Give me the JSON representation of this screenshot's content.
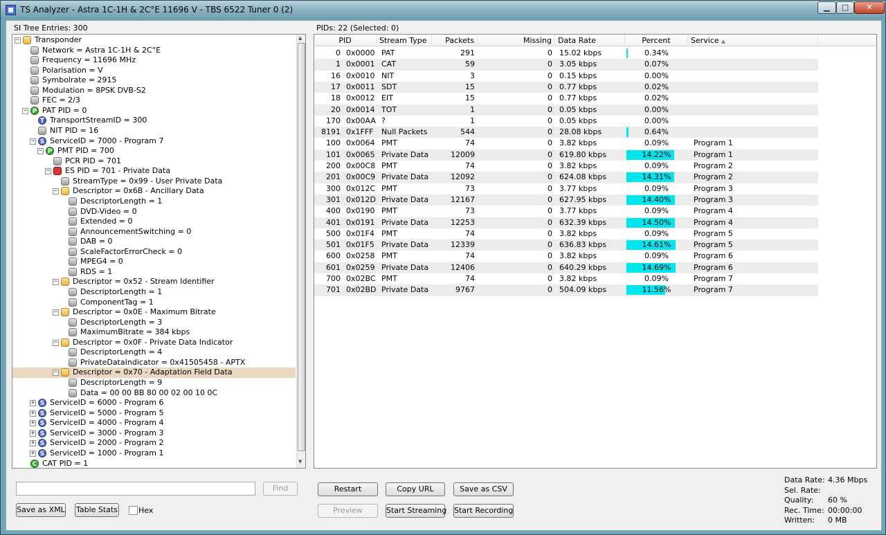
{
  "window": {
    "title": "TS Analyzer - Astra 1C-1H & 2C°E 11696 V - TBS 6522 Tuner 0 (2)",
    "controls": {
      "minimize": "▁",
      "maximize": "□",
      "close": "✕"
    }
  },
  "left": {
    "header": "SI Tree Entries: 300",
    "tree": [
      {
        "label": "Transponder",
        "level": 0,
        "icon": "folder",
        "exp": "-"
      },
      {
        "label": "Network = Astra 1C-1H & 2C°E",
        "level": 1,
        "icon": "gray"
      },
      {
        "label": "Frequency = 11696 MHz",
        "level": 1,
        "icon": "gray"
      },
      {
        "label": "Polarisation = V",
        "level": 1,
        "icon": "gray"
      },
      {
        "label": "Symbolrate = 2915",
        "level": 1,
        "icon": "gray"
      },
      {
        "label": "Modulation = 8PSK DVB-S2",
        "level": 1,
        "icon": "gray"
      },
      {
        "label": "FEC = 2/3",
        "level": 1,
        "icon": "gray"
      },
      {
        "label": "PAT PID = 0",
        "level": 1,
        "icon": "green",
        "glyph": "P",
        "exp": "-"
      },
      {
        "label": "TransportStreamID = 300",
        "level": 2,
        "icon": "blue",
        "glyph": "T"
      },
      {
        "label": "NIT PID = 16",
        "level": 2,
        "icon": "gray"
      },
      {
        "label": "ServiceID = 7000 - Program 7",
        "level": 2,
        "icon": "blue",
        "glyph": "S",
        "exp": "-"
      },
      {
        "label": "PMT PID = 700",
        "level": 3,
        "icon": "green",
        "glyph": "P",
        "exp": "-"
      },
      {
        "label": "PCR PID = 701",
        "level": 4,
        "icon": "gray"
      },
      {
        "label": "ES PID = 701 - Private Data",
        "level": 4,
        "icon": "red",
        "exp": "-"
      },
      {
        "label": "StreamType = 0x99 - User Private Data",
        "level": 5,
        "icon": "gray"
      },
      {
        "label": "Descriptor = 0x6B - Ancillary Data",
        "level": 5,
        "icon": "folder",
        "exp": "-"
      },
      {
        "label": "DescriptorLength = 1",
        "level": 6,
        "icon": "gray"
      },
      {
        "label": "DVD-Video = 0",
        "level": 6,
        "icon": "gray"
      },
      {
        "label": "Extended = 0",
        "level": 6,
        "icon": "gray"
      },
      {
        "label": "AnnouncementSwitching = 0",
        "level": 6,
        "icon": "gray"
      },
      {
        "label": "DAB = 0",
        "level": 6,
        "icon": "gray"
      },
      {
        "label": "ScaleFactorErrorCheck = 0",
        "level": 6,
        "icon": "gray"
      },
      {
        "label": "MPEG4 = 0",
        "level": 6,
        "icon": "gray"
      },
      {
        "label": "RDS = 1",
        "level": 6,
        "icon": "gray"
      },
      {
        "label": "Descriptor = 0x52 - Stream Identifier",
        "level": 5,
        "icon": "folder",
        "exp": "-"
      },
      {
        "label": "DescriptorLength = 1",
        "level": 6,
        "icon": "gray"
      },
      {
        "label": "ComponentTag = 1",
        "level": 6,
        "icon": "gray"
      },
      {
        "label": "Descriptor = 0x0E - Maximum Bitrate",
        "level": 5,
        "icon": "folder",
        "exp": "-"
      },
      {
        "label": "DescriptorLength = 3",
        "level": 6,
        "icon": "gray"
      },
      {
        "label": "MaximumBitrate = 384 kbps",
        "level": 6,
        "icon": "gray"
      },
      {
        "label": "Descriptor = 0x0F - Private Data Indicator",
        "level": 5,
        "icon": "folder",
        "exp": "-"
      },
      {
        "label": "DescriptorLength = 4",
        "level": 6,
        "icon": "gray"
      },
      {
        "label": "PrivateDataIndicator = 0x41505458 - APTX",
        "level": 6,
        "icon": "gray"
      },
      {
        "label": "Descriptor = 0x70 - Adaptation Field Data",
        "level": 5,
        "icon": "folder",
        "exp": "-",
        "selected": true
      },
      {
        "label": "DescriptorLength = 9",
        "level": 6,
        "icon": "gray"
      },
      {
        "label": "Data = 00 00 BB 80 00 02 00 10 0C",
        "level": 6,
        "icon": "gray"
      },
      {
        "label": "ServiceID = 6000 - Program 6",
        "level": 2,
        "icon": "blue",
        "glyph": "S",
        "exp": "+"
      },
      {
        "label": "ServiceID = 5000 - Program 5",
        "level": 2,
        "icon": "blue",
        "glyph": "S",
        "exp": "+"
      },
      {
        "label": "ServiceID = 4000 - Program 4",
        "level": 2,
        "icon": "blue",
        "glyph": "S",
        "exp": "+"
      },
      {
        "label": "ServiceID = 3000 - Program 3",
        "level": 2,
        "icon": "blue",
        "glyph": "S",
        "exp": "+"
      },
      {
        "label": "ServiceID = 2000 - Program 2",
        "level": 2,
        "icon": "blue",
        "glyph": "S",
        "exp": "+"
      },
      {
        "label": "ServiceID = 1000 - Program 1",
        "level": 2,
        "icon": "blue",
        "glyph": "S",
        "exp": "+"
      },
      {
        "label": "CAT PID = 1",
        "level": 1,
        "icon": "green",
        "glyph": "C"
      }
    ],
    "search_value": "",
    "find_label": "Find",
    "save_xml_label": "Save as XML",
    "table_stats_label": "Table Stats",
    "hex_label": "Hex"
  },
  "right": {
    "header": "PIDs: 22   (Selected: 0)",
    "columns": [
      "PID",
      "Stream Type",
      "Packets",
      "Missing",
      "Data Rate",
      "Percent",
      "Service"
    ],
    "rows": [
      {
        "pid": "0",
        "hex": "0x0000",
        "type": "PAT",
        "packets": "291",
        "missing": "0",
        "rate": "15.02 kbps",
        "percent": "0.34%",
        "pct": 0.34,
        "service": ""
      },
      {
        "pid": "1",
        "hex": "0x0001",
        "type": "CAT",
        "packets": "59",
        "missing": "0",
        "rate": "3.05 kbps",
        "percent": "0.07%",
        "pct": 0.07,
        "service": ""
      },
      {
        "pid": "16",
        "hex": "0x0010",
        "type": "NIT",
        "packets": "3",
        "missing": "0",
        "rate": "0.15 kbps",
        "percent": "0.00%",
        "pct": 0,
        "service": ""
      },
      {
        "pid": "17",
        "hex": "0x0011",
        "type": "SDT",
        "packets": "15",
        "missing": "0",
        "rate": "0.77 kbps",
        "percent": "0.02%",
        "pct": 0.02,
        "service": ""
      },
      {
        "pid": "18",
        "hex": "0x0012",
        "type": "EIT",
        "packets": "15",
        "missing": "0",
        "rate": "0.77 kbps",
        "percent": "0.02%",
        "pct": 0.02,
        "service": ""
      },
      {
        "pid": "20",
        "hex": "0x0014",
        "type": "TOT",
        "packets": "1",
        "missing": "0",
        "rate": "0.05 kbps",
        "percent": "0.00%",
        "pct": 0,
        "service": ""
      },
      {
        "pid": "170",
        "hex": "0x00AA",
        "type": "?",
        "packets": "1",
        "missing": "0",
        "rate": "0.05 kbps",
        "percent": "0.00%",
        "pct": 0,
        "service": ""
      },
      {
        "pid": "8191",
        "hex": "0x1FFF",
        "type": "Null Packets",
        "packets": "544",
        "missing": "0",
        "rate": "28.08 kbps",
        "percent": "0.64%",
        "pct": 0.64,
        "service": ""
      },
      {
        "pid": "100",
        "hex": "0x0064",
        "type": "PMT",
        "packets": "74",
        "missing": "0",
        "rate": "3.82 kbps",
        "percent": "0.09%",
        "pct": 0.09,
        "service": "Program 1"
      },
      {
        "pid": "101",
        "hex": "0x0065",
        "type": "Private Data",
        "packets": "12009",
        "missing": "0",
        "rate": "619.80 kbps",
        "percent": "14.22%",
        "pct": 14.22,
        "service": "Program 1"
      },
      {
        "pid": "200",
        "hex": "0x00C8",
        "type": "PMT",
        "packets": "74",
        "missing": "0",
        "rate": "3.82 kbps",
        "percent": "0.09%",
        "pct": 0.09,
        "service": "Program 2"
      },
      {
        "pid": "201",
        "hex": "0x00C9",
        "type": "Private Data",
        "packets": "12092",
        "missing": "0",
        "rate": "624.08 kbps",
        "percent": "14.31%",
        "pct": 14.31,
        "service": "Program 2"
      },
      {
        "pid": "300",
        "hex": "0x012C",
        "type": "PMT",
        "packets": "73",
        "missing": "0",
        "rate": "3.77 kbps",
        "percent": "0.09%",
        "pct": 0.09,
        "service": "Program 3"
      },
      {
        "pid": "301",
        "hex": "0x012D",
        "type": "Private Data",
        "packets": "12167",
        "missing": "0",
        "rate": "627.95 kbps",
        "percent": "14.40%",
        "pct": 14.4,
        "service": "Program 3"
      },
      {
        "pid": "400",
        "hex": "0x0190",
        "type": "PMT",
        "packets": "73",
        "missing": "0",
        "rate": "3.77 kbps",
        "percent": "0.09%",
        "pct": 0.09,
        "service": "Program 4"
      },
      {
        "pid": "401",
        "hex": "0x0191",
        "type": "Private Data",
        "packets": "12253",
        "missing": "0",
        "rate": "632.39 kbps",
        "percent": "14.50%",
        "pct": 14.5,
        "service": "Program 4"
      },
      {
        "pid": "500",
        "hex": "0x01F4",
        "type": "PMT",
        "packets": "74",
        "missing": "0",
        "rate": "3.82 kbps",
        "percent": "0.09%",
        "pct": 0.09,
        "service": "Program 5"
      },
      {
        "pid": "501",
        "hex": "0x01F5",
        "type": "Private Data",
        "packets": "12339",
        "missing": "0",
        "rate": "636.83 kbps",
        "percent": "14.61%",
        "pct": 14.61,
        "service": "Program 5"
      },
      {
        "pid": "600",
        "hex": "0x0258",
        "type": "PMT",
        "packets": "74",
        "missing": "0",
        "rate": "3.82 kbps",
        "percent": "0.09%",
        "pct": 0.09,
        "service": "Program 6"
      },
      {
        "pid": "601",
        "hex": "0x0259",
        "type": "Private Data",
        "packets": "12406",
        "missing": "0",
        "rate": "640.29 kbps",
        "percent": "14.69%",
        "pct": 14.69,
        "service": "Program 6"
      },
      {
        "pid": "700",
        "hex": "0x02BC",
        "type": "PMT",
        "packets": "74",
        "missing": "0",
        "rate": "3.82 kbps",
        "percent": "0.09%",
        "pct": 0.09,
        "service": "Program 7"
      },
      {
        "pid": "701",
        "hex": "0x02BD",
        "type": "Private Data",
        "packets": "9767",
        "missing": "0",
        "rate": "504.09 kbps",
        "percent": "11.56%",
        "pct": 11.56,
        "service": "Program 7"
      }
    ],
    "buttons": {
      "restart": "Restart",
      "copy_url": "Copy URL",
      "save_csv": "Save as CSV",
      "preview": "Preview",
      "start_streaming": "Start Streaming",
      "start_recording": "Start Recording"
    },
    "stats": [
      {
        "key": "Data Rate:",
        "value": "4.36 Mbps"
      },
      {
        "key": "Sel. Rate:",
        "value": ""
      },
      {
        "key": "Quality:",
        "value": "60 %"
      },
      {
        "key": "Rec. Time:",
        "value": "00:00:00"
      },
      {
        "key": "Written:",
        "value": "0 MB"
      }
    ]
  },
  "colors": {
    "percent_bar": "#00e5ee",
    "selection": "#ead8c0"
  }
}
